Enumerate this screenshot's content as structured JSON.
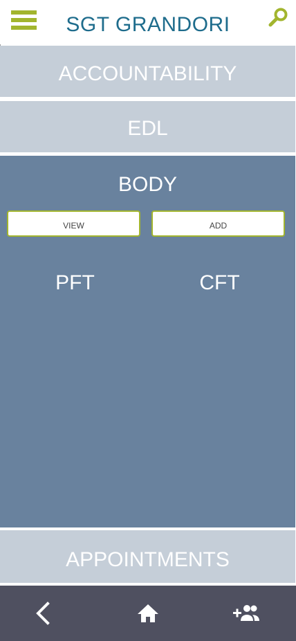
{
  "header": {
    "title": "SGT GRANDORI",
    "menu_icon": "hamburger-menu-icon",
    "search_icon": "search-icon",
    "accent_color": "#a2b52e",
    "title_color": "#1e6c8c"
  },
  "sections": {
    "accountability": {
      "label": "ACCOUNTABILITY"
    },
    "edl": {
      "label": "EDL"
    },
    "body": {
      "label": "BODY",
      "view_button": "VIEW",
      "add_button": "ADD",
      "items": [
        {
          "label": "PFT"
        },
        {
          "label": "CFT"
        }
      ]
    },
    "appointments": {
      "label": "APPOINTMENTS"
    }
  },
  "bottom_nav": {
    "back_icon": "chevron-left-icon",
    "home_icon": "home-icon",
    "add_user_icon": "person-add-icon",
    "background": "#4f5060"
  },
  "colors": {
    "section_light": "#c5ced8",
    "section_dark": "#69829e"
  }
}
